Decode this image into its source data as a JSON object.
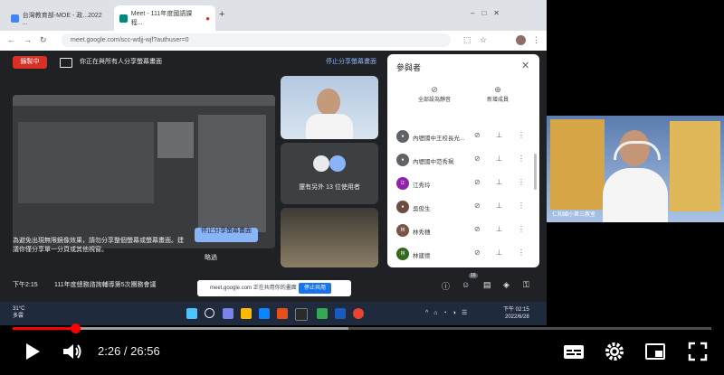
{
  "browser": {
    "tabs": [
      {
        "label": "台灣教育部-MOE - 政...2022 ...",
        "color": "#4285f4"
      },
      {
        "label": "Meet - 111年度國語課程...",
        "color": "#00897b"
      }
    ],
    "new_tab": "+",
    "url": "meet.google.com/scc-wdjj-wjf?authuser=0"
  },
  "meet": {
    "recording_label": "錄製中",
    "presenting_text": "你正在與所有人分享螢幕畫面",
    "stop_presenting_link": "停止分享螢幕畫面",
    "shared_notice": "為避免出現無限鏡像效果，請勿分享整個螢幕或螢幕畫面。建議你僅分享單一分頁或其他視窗。",
    "stop_presenting_button": "停止分享螢幕畫面",
    "dismiss": "略過",
    "others_label": "還有另外 13 位使用者",
    "bottom_time": "下午2:15",
    "bottom_title": "111年度總務諮詢輔導第5次團務會議",
    "toast_text": "meet.google.com 正在共用你的畫面",
    "toast_button": "停止共用",
    "participants_badge": "16"
  },
  "panel": {
    "title": "參與者",
    "close": "✕",
    "action_mute_all": "全部設為靜音",
    "action_add": "新增成員",
    "participants": [
      {
        "initial": "●",
        "name": "內壢國中王校長光...",
        "color": "#5f6368"
      },
      {
        "initial": "●",
        "name": "內壢國中范秀珮",
        "color": "#5f6368"
      },
      {
        "initial": "江",
        "name": "江秀玲",
        "color": "#8e24aa"
      },
      {
        "initial": "●",
        "name": "吳俊生",
        "color": "#6d4c41"
      },
      {
        "initial": "林",
        "name": "林秀穗",
        "color": "#795548"
      },
      {
        "initial": "林",
        "name": "林建德",
        "color": "#33691e"
      }
    ]
  },
  "taskbar": {
    "weather_temp": "31°C",
    "weather_desc": "多雲",
    "clock_time": "下午 02:15",
    "clock_date": "2022/6/28"
  },
  "webcam": {
    "label": "仁和國小第三教室"
  },
  "player": {
    "current_time": "2:26",
    "separator": " / ",
    "duration": "26:56",
    "progress_fraction": 0.09,
    "buffer_fraction": 0.48,
    "icons": [
      "play-icon",
      "volume-icon",
      "subtitles-icon",
      "settings-icon",
      "miniplayer-icon",
      "fullscreen-icon"
    ]
  }
}
